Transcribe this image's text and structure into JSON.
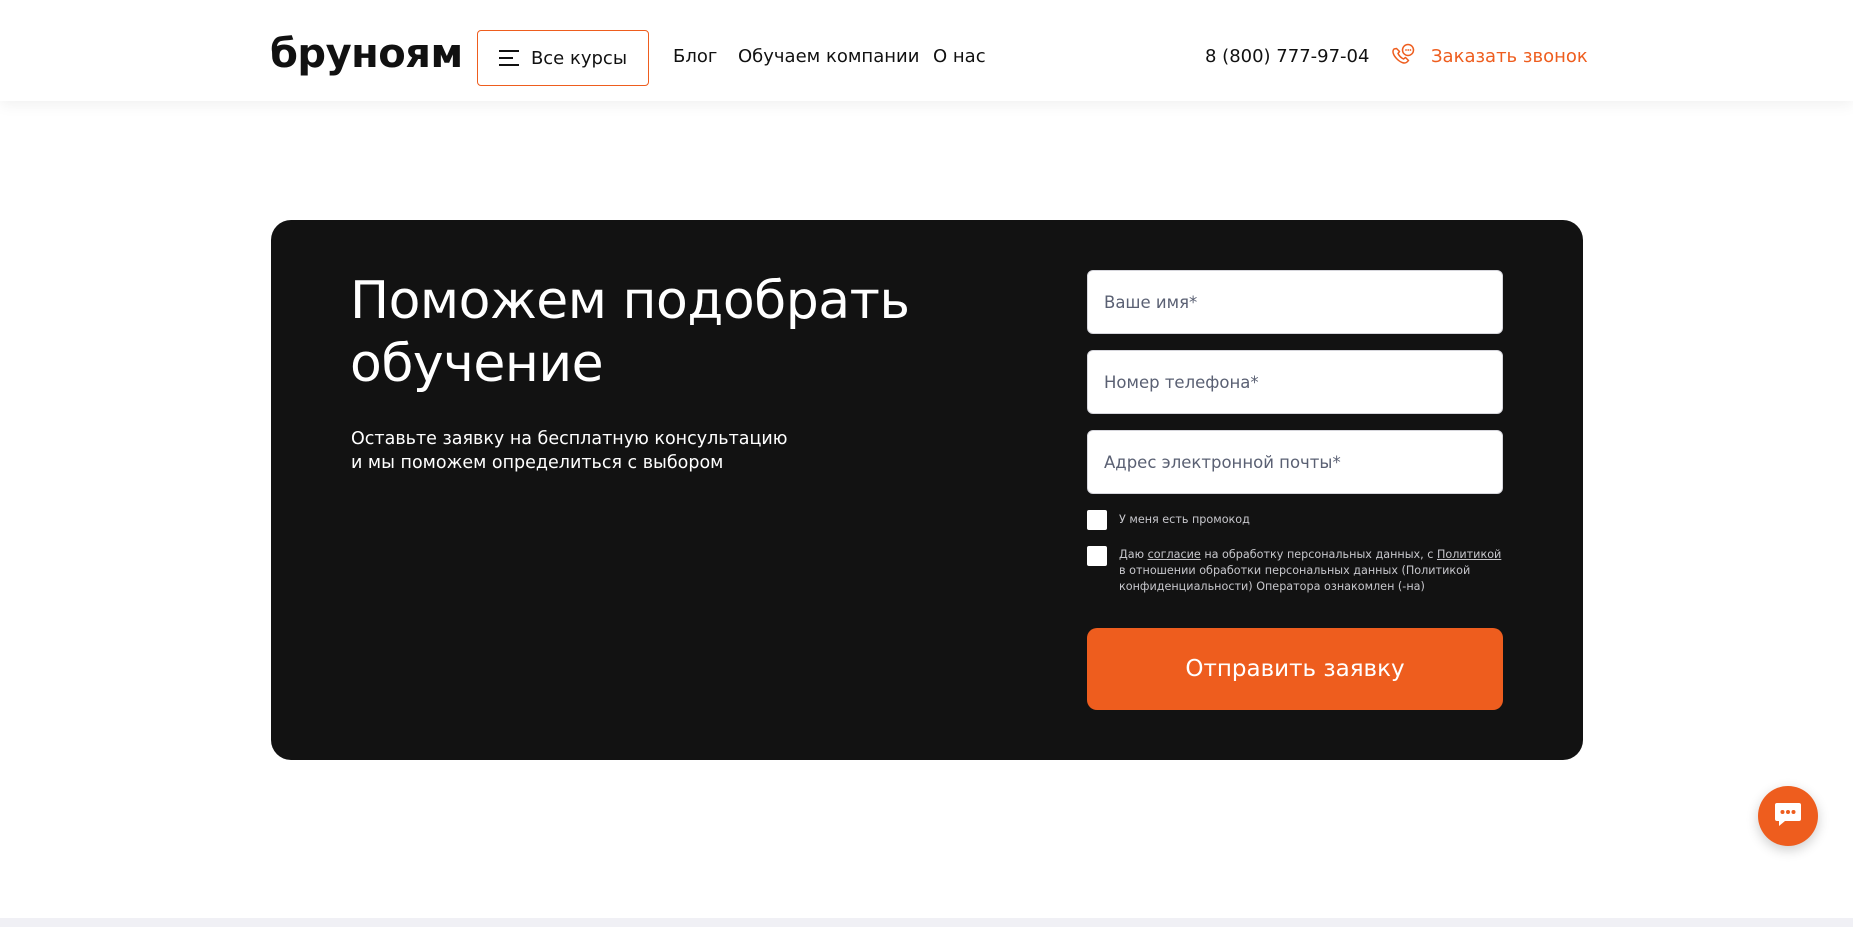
{
  "header": {
    "logo": "бруноям",
    "courses_button": "Все курсы",
    "nav": {
      "blog": "Блог",
      "companies": "Обучаем компании",
      "about": "О нас"
    },
    "phone": "8 (800) 777-97-04",
    "callback": "Заказать звонок"
  },
  "form": {
    "heading_line1": "Поможем подобрать",
    "heading_line2": "обучение",
    "subtext_line1": "Оставьте заявку на бесплатную консультацию",
    "subtext_line2": "и мы поможем определиться с выбором",
    "name_placeholder": "Ваше имя*",
    "phone_placeholder": "Номер телефона*",
    "email_placeholder": "Адрес электронной почты*",
    "promo_label": "У меня есть промокод",
    "consent_pre": "Даю ",
    "consent_link": "согласие",
    "consent_mid": " на обработку персональных данных, с ",
    "policy_link": "Политикой",
    "consent_post": " в отношении обработки персональных данных (Политикой конфиденциальности) Оператора ознакомлен (-на)",
    "submit": "Отправить заявку"
  },
  "colors": {
    "accent": "#ee5d1e",
    "card_bg": "#121212"
  },
  "icons": {
    "menu": "burger-menu-icon",
    "callback": "phone-chat-icon",
    "chat": "chat-bubble-icon"
  }
}
